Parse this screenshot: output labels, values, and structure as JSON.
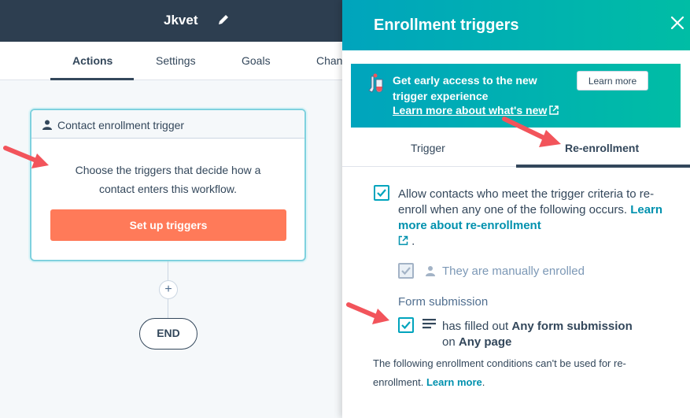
{
  "workflow": {
    "title": "Jkvet",
    "tabs": [
      {
        "label": "Actions",
        "active": true
      },
      {
        "label": "Settings",
        "active": false
      },
      {
        "label": "Goals",
        "active": false
      },
      {
        "label": "Chan",
        "active": false
      }
    ]
  },
  "trigger_card": {
    "header": "Contact enrollment trigger",
    "line1": "Choose the triggers that decide how a",
    "line2": "contact enters this workflow.",
    "button": "Set up triggers"
  },
  "canvas": {
    "add_symbol": "+",
    "end_label": "END"
  },
  "panel": {
    "title": "Enrollment triggers",
    "banner": {
      "text": "Get early access to the new trigger experience",
      "link": "Learn more about what's new",
      "button": "Learn more"
    },
    "tabs": [
      {
        "label": "Trigger",
        "active": false
      },
      {
        "label": "Re-enrollment",
        "active": true
      }
    ],
    "reenroll": {
      "text": "Allow contacts who meet the trigger criteria to re-enroll when any one of the following occurs.",
      "link": "Learn more about re-enrollment",
      "after_icon": ".",
      "checked": true
    },
    "manual": {
      "label": "They are manually enrolled",
      "checked": true,
      "disabled": true
    },
    "form": {
      "heading": "Form submission",
      "prefix": "has filled out",
      "form_name": "Any form submission",
      "on": "on",
      "page": "Any page",
      "checked": true
    },
    "note": {
      "text": "The following enrollment conditions can't be used for re-enrollment.",
      "link": "Learn more",
      "end": "."
    }
  },
  "colors": {
    "topbar": "#2d3e50",
    "accent_teal": "#00a4bd",
    "cta_orange": "#ff7a59",
    "annotation_red": "#f2545b"
  },
  "icons": [
    "pencil-icon",
    "person-icon",
    "close-icon",
    "flask-icon",
    "external-link-icon",
    "checkmark-icon",
    "lines-icon",
    "annotation-arrow"
  ]
}
